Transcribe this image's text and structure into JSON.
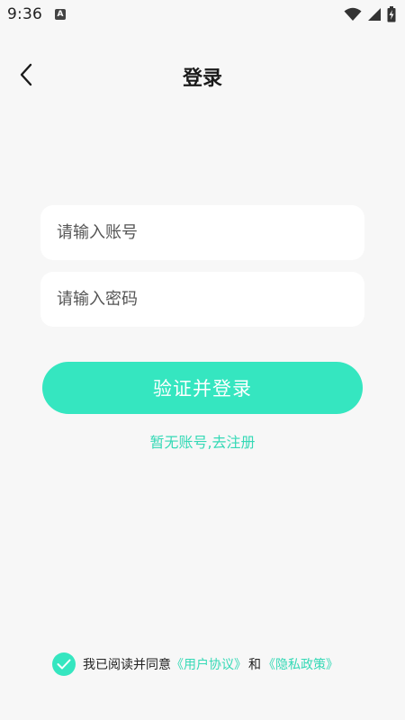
{
  "status_bar": {
    "time": "9:36",
    "icons": [
      "notification-a-icon",
      "wifi-icon",
      "cellular-signal-icon",
      "battery-charging-icon"
    ]
  },
  "header": {
    "title": "登录",
    "back_icon": "chevron-left-icon"
  },
  "form": {
    "account_placeholder": "请输入账号",
    "account_value": "",
    "password_placeholder": "请输入密码",
    "password_value": "",
    "submit_label": "验证并登录",
    "register_link": "暂无账号,去注册"
  },
  "agreement": {
    "checked": true,
    "prefix": "我已阅读并同意",
    "user_agreement": "《用户协议》",
    "conjunction": "和",
    "privacy_policy": "《隐私政策》"
  },
  "colors": {
    "accent": "#35e6c0",
    "link": "#35d9b6",
    "background": "#f7f7f7"
  }
}
